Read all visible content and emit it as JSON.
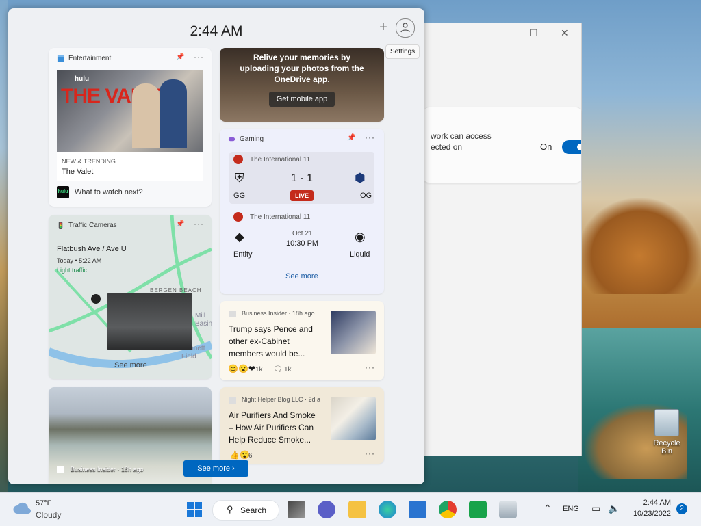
{
  "panel": {
    "time": "2:44 AM",
    "tooltip": "Settings"
  },
  "entertainment": {
    "category": "Entertainment",
    "poster_brand": "hulu",
    "poster_title": "THE VALET",
    "label": "NEW & TRENDING",
    "title": "The Valet",
    "footer": "What to watch next?",
    "footer_logo": "hulu"
  },
  "onedrive": {
    "message_line1": "Relive your memories by",
    "message_line2": "uploading your photos from the",
    "message_line3": "OneDrive app.",
    "button": "Get mobile app"
  },
  "gaming": {
    "category": "Gaming",
    "match1": {
      "event": "The International 11",
      "team_a": "GG",
      "team_b": "OG",
      "score": "1 - 1",
      "status": "LIVE"
    },
    "match2": {
      "event": "The International 11",
      "team_a": "Entity",
      "team_b": "Liquid",
      "date": "Oct 21",
      "time": "10:30 PM"
    },
    "see_more": "See more"
  },
  "traffic": {
    "category": "Traffic Cameras",
    "location": "Flatbush Ave / Ave U",
    "time": "Today • 5:22 AM",
    "status": "Light traffic",
    "map_label1": "BERGEN BEACH",
    "map_label2": "Mill Basin",
    "map_label3": "Bennett Field",
    "see_more": "See more"
  },
  "news1": {
    "source": "Business Insider · 18h ago",
    "headline_lines": [
      "Trump says Pence and",
      "other ex-Cabinet",
      "members would be..."
    ],
    "reactions": "1k",
    "comments": "1k"
  },
  "news2": {
    "source": "Night Helper Blog LLC · 2d a",
    "headline_lines": [
      "Air Purifiers And Smoke",
      "– How Air Purifiers Can",
      "Help Reduce Smoke..."
    ],
    "reactions": "6"
  },
  "photo_card": {
    "source": "Business Insider · 18h ago"
  },
  "see_more_button": "See more",
  "settings_window": {
    "line1": "work can access",
    "line2": "ected on",
    "toggle_label": "On"
  },
  "taskbar": {
    "weather_temp": "57°F",
    "weather_desc": "Cloudy",
    "search_label": "Search",
    "language": "ENG",
    "time": "2:44 AM",
    "date": "10/23/2022",
    "notifications": "2"
  },
  "desktop": {
    "recycle_bin": "Recycle Bin"
  },
  "colors": {
    "accent": "#0067c0",
    "live_badge": "#c42b1c",
    "panel_bg": "#eef0f3"
  }
}
